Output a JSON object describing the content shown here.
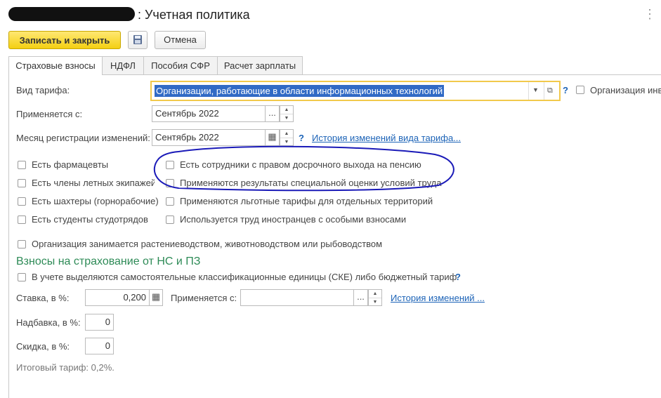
{
  "window": {
    "title": ": Учетная политика",
    "more_label": "⋮"
  },
  "toolbar": {
    "save_close_label": "Записать и закрыть",
    "save_icon": "floppy-icon",
    "cancel_label": "Отмена"
  },
  "tabs": [
    {
      "label": "Страховые взносы",
      "active": true
    },
    {
      "label": "НДФЛ",
      "active": false
    },
    {
      "label": "Пособия СФР",
      "active": false
    },
    {
      "label": "Расчет зарплаты",
      "active": false
    }
  ],
  "tariff": {
    "label": "Вид тарифа:",
    "value": "Организации, работающие в области информационных технологий",
    "help": "?",
    "org_checkbox_label": "Организация инв"
  },
  "applies_from": {
    "label": "Применяется с:",
    "value": "Сентябрь 2022"
  },
  "reg_month": {
    "label": "Месяц регистрации изменений:",
    "value": "Сентябрь 2022",
    "help": "?",
    "history_link": "История изменений вида тарифа..."
  },
  "checkboxes_left": [
    "Есть фармацевты",
    "Есть члены летных экипажей",
    "Есть шахтеры (горнорабочие)",
    "Есть студенты студотрядов"
  ],
  "checkboxes_right": [
    "Есть сотрудники с правом досрочного выхода на пенсию",
    "Применяются результаты специальной оценки условий труда",
    "Применяются льготные тарифы для отдельных территорий",
    "Используется труд иностранцев с особыми взносами"
  ],
  "agri_checkbox": "Организация занимается растениеводством, животноводством или рыбоводством",
  "ns_section": {
    "heading": "Взносы на страхование от НС и ПЗ",
    "ske_checkbox": "В учете выделяются самостоятельные классификационные единицы (СКЕ) либо бюджетный тариф",
    "help": "?",
    "rate_label": "Ставка, в %:",
    "rate_value": "0,200",
    "applies_label": "Применяется с:",
    "applies_value": "",
    "history_link": "История изменений ...",
    "markup_label": "Надбавка, в %:",
    "markup_value": "0",
    "discount_label": "Скидка, в %:",
    "discount_value": "0",
    "total": "Итоговый тариф: 0,2%."
  },
  "colors": {
    "accent_yellow": "#f4cf12",
    "link_blue": "#1c63b7",
    "section_green": "#2e8b57",
    "annotation_blue": "#1a1ab8"
  }
}
